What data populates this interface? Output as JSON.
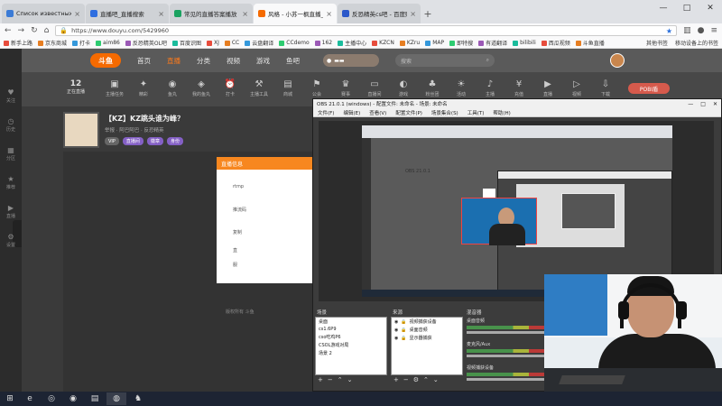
{
  "browser": {
    "tabs": [
      {
        "title": "Список известных мне игр",
        "fav_color": "#3b7bd6",
        "active": false
      },
      {
        "title": "直播吧_直播搜索",
        "fav_color": "#2f6ee0",
        "active": false
      },
      {
        "title": "常见的直播答案播放 - 直播单页面",
        "fav_color": "#1aa260",
        "active": false
      },
      {
        "title": "风格 - 小苏一枫直播_反恐精英",
        "fav_color": "#f56a00",
        "active": true
      },
      {
        "title": "反恐精英cs吧 - 百度贴吧 - 本吧",
        "fav_color": "#2b58c9",
        "active": false
      }
    ],
    "url": "https://www.douyu.com/5429960",
    "bookmarks": [
      "新手上路",
      "京东商城",
      "打卡",
      "aim86",
      "反恐精英OL吧",
      "百度识图",
      "XJ",
      "CC",
      "云盘翻译",
      "CCdemo",
      "162",
      "主播中心",
      "KZCN",
      "KZru",
      "MAP",
      "即特搜",
      "有道翻译",
      "bilibili",
      "西瓜视频",
      "斗鱼直播"
    ],
    "bookmarks_right": [
      "其他书签",
      "移动设备上的书签"
    ]
  },
  "douyu": {
    "logo": "斗鱼",
    "nav": [
      "首页",
      "直播",
      "分类",
      "视频",
      "游戏",
      "鱼吧"
    ],
    "active_nav": "直播",
    "search_placeholder": "搜索",
    "left_items": [
      "关注",
      "历史",
      "分区",
      "推荐",
      "直播",
      "设置"
    ],
    "follow": {
      "count": "12",
      "label": "正在直播"
    },
    "tools": [
      "主播任务",
      "精彩",
      "鱼丸",
      "我的鱼丸",
      "打卡",
      "主播工具",
      "商城",
      "公会",
      "赛事",
      "直播间",
      "游戏",
      "粉丝团",
      "活动",
      "主播",
      "充值",
      "直播",
      "视频",
      "下载"
    ],
    "pobi_label": "POBI盾",
    "room": {
      "title": "【KZ】KZ跳头谁为峰？",
      "meta": "举报 · 阿巴阿巴 · 反恐精英",
      "tags": [
        "VIP",
        "直播间",
        "徽章",
        "身份"
      ]
    },
    "popup": {
      "header": "直播信息",
      "lines": [
        "rtmp",
        "推流码",
        "复制",
        "直",
        "服"
      ]
    },
    "footer_note": "版权所有 斗鱼"
  },
  "obs": {
    "title": "OBS 21.0.1 (windows) - 配置文件: 未命名 - 场景: 未命名",
    "window_controls": [
      "—",
      "□",
      "✕"
    ],
    "menu": [
      "文件(F)",
      "编辑(E)",
      "查看(V)",
      "配置文件(P)",
      "场景集合(S)",
      "工具(T)",
      "帮助(H)"
    ],
    "docks": {
      "scenes": {
        "header": "场景",
        "items": [
          "桌面",
          "cs1.6P9",
          "cso吃鸡P6",
          "CSOL游戏对局",
          "场景 2"
        ]
      },
      "sources": {
        "header": "来源",
        "items": [
          "视频捕获设备",
          "桌面音频",
          "显示器捕获"
        ]
      },
      "mixer": {
        "header": "混音器",
        "items": [
          "桌面音频",
          "麦克风/Aux",
          "视频捕获设备"
        ]
      }
    },
    "nested_label": "OBS 21.0.1"
  },
  "taskbar": {
    "items": [
      "start-icon",
      "ie-icon",
      "steam-icon",
      "firefox-icon",
      "explorer-icon",
      "obs-icon",
      "cs-icon"
    ],
    "time": ""
  }
}
